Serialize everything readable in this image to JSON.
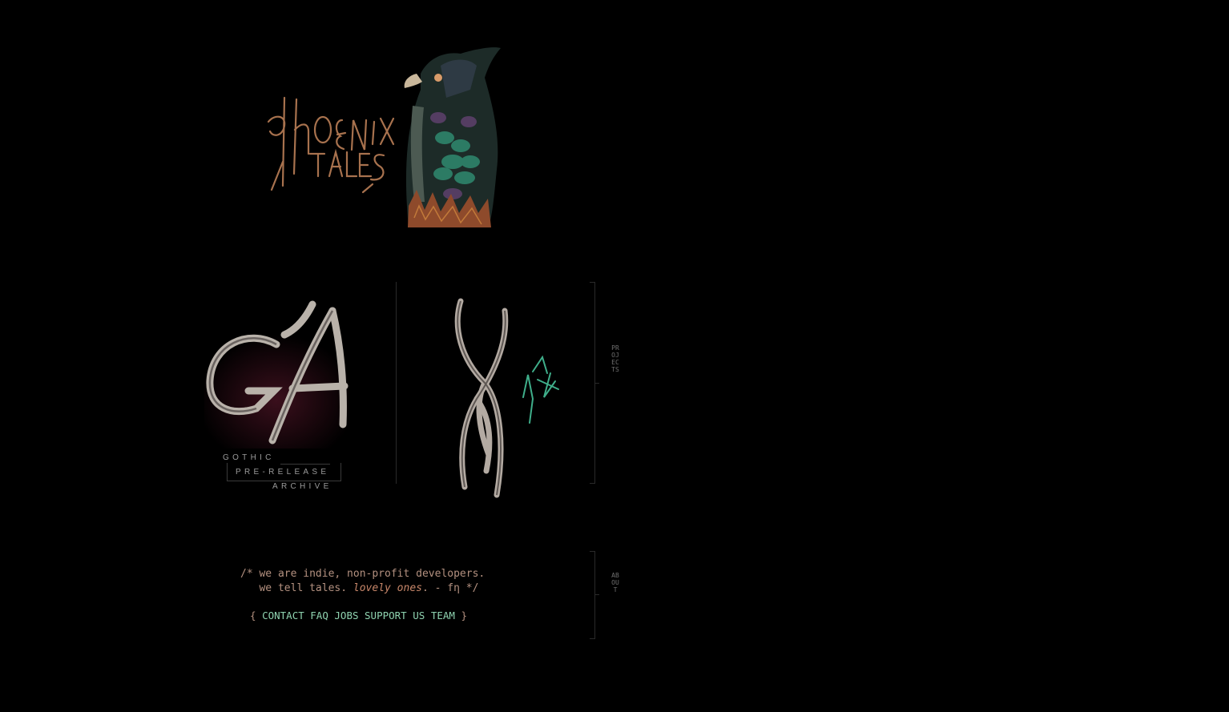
{
  "logo": {
    "line1": "phoenix",
    "line2": "tales"
  },
  "projects_section": {
    "label": "PROJECTS",
    "gothic": {
      "line1": "GOTHIC",
      "line2": "PRE-RELEASE",
      "line3": "ARCHIVE"
    }
  },
  "about_section": {
    "label": "ABOUT",
    "line1": "/* we are indie, non-profit developers.",
    "line2_a": "   we tell tales. ",
    "line2_em": "lovely ones",
    "line2_b": ". - fη */",
    "nav_open": "{ ",
    "nav_close": " }",
    "links": [
      "CONTACT",
      "FAQ",
      "JOBS",
      "SUPPORT US",
      "TEAM"
    ]
  },
  "colors": {
    "background": "#000000",
    "text": "#b49180",
    "link": "#8fd3b0",
    "accent_rune": "#3fae8a"
  }
}
